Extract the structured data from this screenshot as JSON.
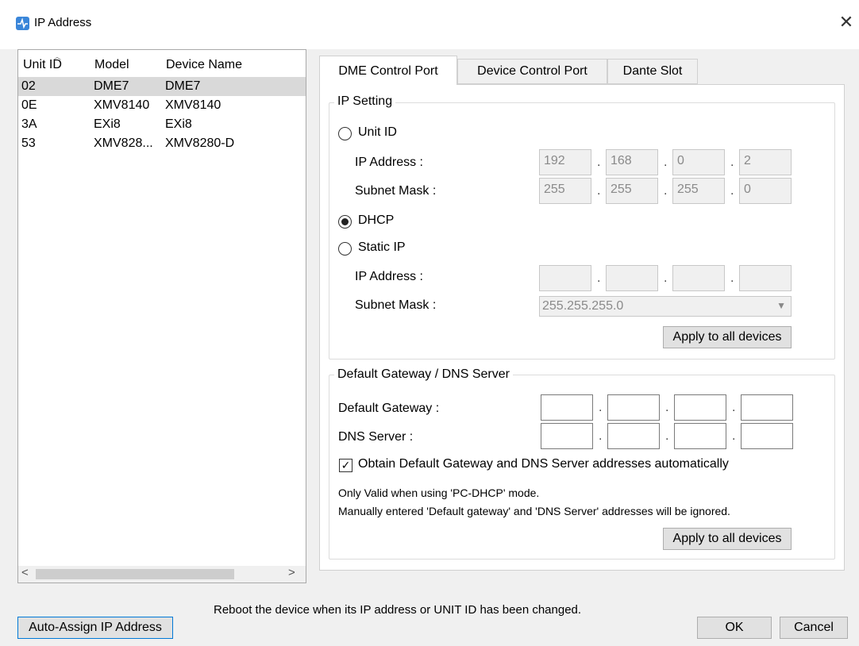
{
  "window": {
    "title": "IP Address",
    "close_glyph": "✕"
  },
  "device_list": {
    "columns": [
      "Unit ID",
      "Model",
      "Device Name"
    ],
    "rows": [
      {
        "unit_id": "02",
        "model": "DME7",
        "device_name": "DME7"
      },
      {
        "unit_id": "0E",
        "model": "XMV8140",
        "device_name": "XMV8140"
      },
      {
        "unit_id": "3A",
        "model": "EXi8",
        "device_name": "EXi8"
      },
      {
        "unit_id": "53",
        "model": "XMV828...",
        "device_name": "XMV8280-D"
      }
    ],
    "selected_row": 0,
    "scroll_left": "<",
    "scroll_right": ">"
  },
  "tabs": [
    "DME Control Port",
    "Device Control Port",
    "Dante Slot"
  ],
  "active_tab": 0,
  "ip_setting": {
    "group_title": "IP Setting",
    "unit_id_option": "Unit ID",
    "ip_address_label": "IP Address :",
    "subnet_mask_label": "Subnet Mask :",
    "unit_ip": [
      "192",
      "168",
      "0",
      "2"
    ],
    "unit_mask": [
      "255",
      "255",
      "255",
      "0"
    ],
    "dhcp_option": "DHCP",
    "static_option": "Static IP",
    "static_ip": [
      "",
      "",
      "",
      ""
    ],
    "static_mask": "255.255.255.0",
    "selected_mode": "DHCP",
    "apply_button": "Apply to all devices"
  },
  "gateway": {
    "group_title": "Default Gateway / DNS Server",
    "gateway_label": "Default Gateway :",
    "dns_label": "DNS Server :",
    "gateway_values": [
      "",
      "",
      "",
      ""
    ],
    "dns_values": [
      "",
      "",
      "",
      ""
    ],
    "auto_checkbox_label": "Obtain Default Gateway and DNS Server addresses automatically",
    "auto_checked": true,
    "note_line1": "Only Valid when using 'PC-DHCP' mode.",
    "note_line2": "Manually entered 'Default gateway' and 'DNS Server' addresses will be ignored.",
    "apply_button": "Apply to all devices"
  },
  "footer": {
    "reboot_note": "Reboot the device when its IP address or UNIT ID has been changed.",
    "auto_assign_button": "Auto-Assign IP Address",
    "ok_button": "OK",
    "cancel_button": "Cancel"
  },
  "colors": {
    "accent": "#3a86d9",
    "selected_row": "#d9d9d9",
    "focus_border": "#0078d7"
  }
}
